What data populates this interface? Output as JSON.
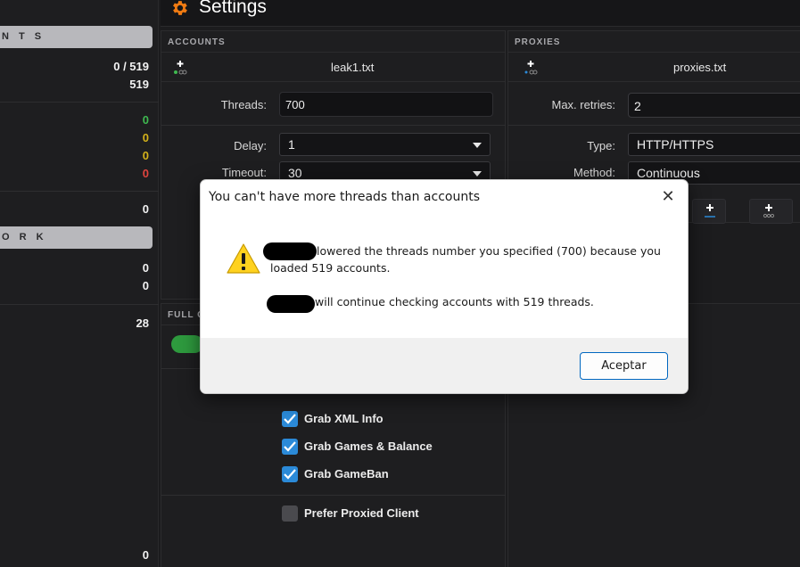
{
  "app": {
    "title": "Settings"
  },
  "left": {
    "section1_label": "N T S",
    "section2_label": "O R K",
    "progress": "0 / 519",
    "total": "519",
    "hits": "0",
    "free": "0",
    "custom": "0",
    "fails": "0",
    "retries": "0",
    "net1": "0",
    "net2": "0",
    "cpm": "28",
    "bottom": "0"
  },
  "accounts": {
    "header": "ACCOUNTS",
    "file": "leak1.txt",
    "threads_label": "Threads:",
    "threads_value": "700",
    "delay_label": "Delay:",
    "delay_value": "1",
    "timeout_label": "Timeout:",
    "timeout_value": "30"
  },
  "proxies": {
    "header": "PROXIES",
    "file": "proxies.txt",
    "retries_label": "Max. retries:",
    "retries_value": "2",
    "type_label": "Type:",
    "type_value": "HTTP/HTTPS",
    "method_label": "Method:",
    "method_value": "Continuous"
  },
  "capture": {
    "header": "FULL C",
    "options": [
      {
        "label": "Grab XML Info",
        "checked": true
      },
      {
        "label": "Grab Games & Balance",
        "checked": true
      },
      {
        "label": "Grab GameBan",
        "checked": true
      }
    ],
    "prefer": {
      "label": "Prefer Proxied Client",
      "checked": false
    }
  },
  "dialog": {
    "title": "You can't have more threads than accounts",
    "line1a": "lowered the threads number you specified (700) because you",
    "line1b": "loaded 519 accounts.",
    "line2": "will continue checking accounts with 519 threads.",
    "ok_label": "Aceptar"
  },
  "colors": {
    "accent": "#f07b12",
    "check": "#2b8ad8",
    "green": "#3fb950",
    "yellow": "#d4b21a",
    "red": "#e0443e"
  }
}
